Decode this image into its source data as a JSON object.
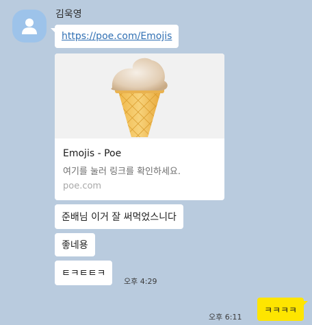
{
  "chat": {
    "sender_name": "김욱영",
    "messages": [
      {
        "text": "https://poe.com/Emojis"
      },
      {
        "text": "준배님 이거 잘 써먹었스니다"
      },
      {
        "text": "좋네용"
      },
      {
        "text": "ㅌㅋㅌㅌㅋ",
        "time": "오후 4:29"
      }
    ],
    "link_preview": {
      "title": "Emojis - Poe",
      "description": "여기를 눌러 링크를 확인하세요.",
      "domain": "poe.com",
      "image_icon": "ice-cream-cone-icon"
    },
    "my_message": {
      "text": "ㅋㅋㅋㅋ",
      "time": "오후 6:11"
    }
  },
  "colors": {
    "background": "#b9cbde",
    "my_bubble": "#fee500",
    "other_bubble": "#ffffff",
    "avatar": "#9dc3ea",
    "link": "#2f6fb3"
  }
}
